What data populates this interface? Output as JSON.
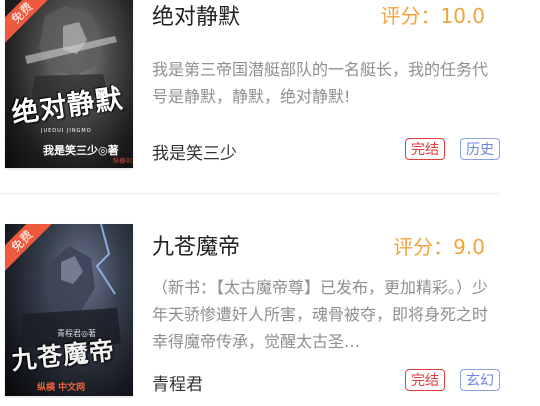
{
  "books": [
    {
      "cover_badge": "免费",
      "cover_title": "绝对静默",
      "cover_subtitle": "JUEDUI JINGMO",
      "cover_author": "我是笑三少◎著",
      "cover_publisher": "纵横中文网",
      "title": "绝对静默",
      "score": "评分：10.0",
      "intro": "我是第三帝国潜艇部队的一名艇长，我的任务代号是静默，静默，绝对静默!",
      "author": "我是笑三少",
      "status_tag": "完结",
      "genre_tag": "历史"
    },
    {
      "cover_badge": "免费",
      "cover_title": "九苍魔帝",
      "cover_author": "青程君◎著",
      "cover_publisher": "纵横 中文网",
      "title": "九苍魔帝",
      "score": "评分：9.0",
      "intro": "（新书：【太古魔帝尊】已发布，更加精彩。）少年天骄惨遭奸人所害，魂骨被夺，即将身死之时幸得魔帝传承，觉醒太古圣…",
      "author": "青程君",
      "status_tag": "完结",
      "genre_tag": "玄幻"
    }
  ],
  "colors": {
    "score": "#f2a43c",
    "status_tag": "#e23c3c",
    "genre_tag": "#6b86d8",
    "free_ribbon": "#ef5a3e",
    "intro_text": "#8f8f8f"
  }
}
